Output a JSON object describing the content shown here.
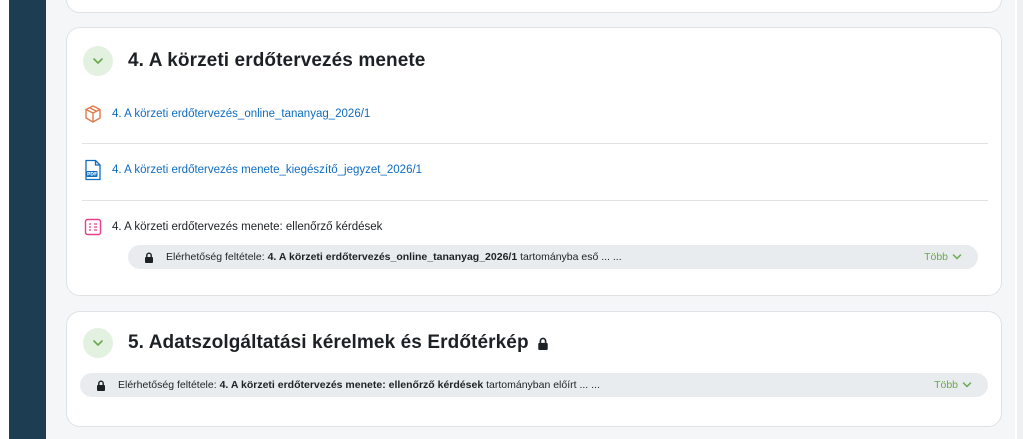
{
  "section4": {
    "title": "4. A körzeti erdőtervezés menete",
    "activities": [
      {
        "icon": "package-icon",
        "label": "4. A körzeti erdőtervezés_online_tananyag_2026/1",
        "type": "link"
      },
      {
        "icon": "pdf-icon",
        "label": "4. A körzeti erdőtervezés menete_kiegészítő_jegyzet_2026/1",
        "type": "link"
      },
      {
        "icon": "quiz-icon",
        "label": "4. A körzeti erdőtervezés menete: ellenőrző kérdések",
        "type": "text"
      }
    ],
    "restriction": {
      "prefix": "Elérhetőség feltétele:",
      "bold": "4. A körzeti erdőtervezés_online_tananyag_2026/1",
      "suffix": "tartományba eső ... ...",
      "more_label": "Több"
    }
  },
  "section5": {
    "title": "5. Adatszolgáltatási kérelmek és Erdőtérkép",
    "restriction": {
      "prefix": "Elérhetőség feltétele:",
      "bold": "4. A körzeti erdőtervezés menete: ellenőrző kérdések",
      "suffix": "tartományban előírt ... ...",
      "more_label": "Több"
    }
  },
  "colors": {
    "sidebar": "#1d3e52",
    "link": "#0f6cbf",
    "toggle_bg": "#e3f1e1",
    "more": "#6aa84f",
    "restriction_bg": "#e9ecef"
  }
}
